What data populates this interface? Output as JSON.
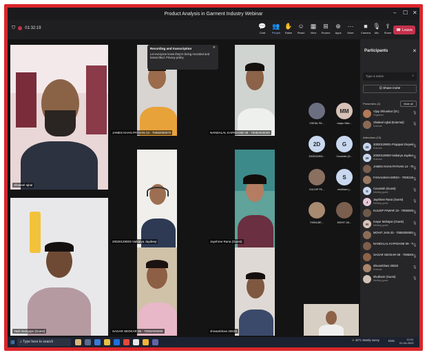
{
  "window": {
    "title": "Product Analysis in Garment Industry Webinar"
  },
  "topbar": {
    "timer": "01:32:19",
    "buttons": [
      {
        "id": "chat",
        "label": "Chat",
        "icon": "chat-icon"
      },
      {
        "id": "people",
        "label": "People",
        "icon": "people-icon"
      },
      {
        "id": "raise",
        "label": "Raise",
        "icon": "hand-icon"
      },
      {
        "id": "react",
        "label": "React",
        "icon": "smile-icon"
      },
      {
        "id": "view",
        "label": "View",
        "icon": "grid-icon"
      },
      {
        "id": "rooms",
        "label": "Rooms",
        "icon": "rooms-icon"
      },
      {
        "id": "apps",
        "label": "Apps",
        "icon": "apps-icon"
      },
      {
        "id": "more",
        "label": "More",
        "icon": "more-icon"
      },
      {
        "id": "camera",
        "label": "Camera",
        "icon": "camera-icon"
      },
      {
        "id": "mic",
        "label": "Mic",
        "icon": "mic-icon"
      },
      {
        "id": "share",
        "label": "Share",
        "icon": "share-icon"
      }
    ],
    "leave_label": "Leave"
  },
  "toast": {
    "title": "Recording and transcription",
    "body": "Let everyone know they're being recorded and transcribed. Privacy policy"
  },
  "tiles": [
    {
      "label": "Shakeel Iqbal"
    },
    {
      "label": "JAMES KHAN PATHAN 13 - 70082000070"
    },
    {
      "label": "NANDALAL KAPADANE 09 - 70082000009"
    },
    {
      "label": "20020129003-Vaikarya Jaydeep"
    },
    {
      "label": "Jayshree Rana (Guest)"
    },
    {
      "label": "Yash Barlgujar (Guest)"
    },
    {
      "label": "SAGAR SEOKAR 06 - 70082000008"
    },
    {
      "label": "shivambhavi 20633"
    }
  ],
  "thumbnails": [
    {
      "initials": "",
      "name": "VISHAL PA..."
    },
    {
      "initials": "MM",
      "name": "mayur Mah..."
    },
    {
      "initials": "2D",
      "name": "2002012900..."
    },
    {
      "initials": "G",
      "name": "Covanish (G..."
    },
    {
      "initials": "",
      "name": "KULDIP PA..."
    },
    {
      "initials": "S",
      "name": "shubham (..."
    },
    {
      "initials": "",
      "name": "FARALBE..."
    },
    {
      "initials": "",
      "name": "MOHIT JAI..."
    }
  ],
  "panel": {
    "title": "Participants",
    "search_placeholder": "Type a name",
    "invite_label": "Share invite",
    "presenters_label": "Presenters (2)",
    "mute_all_label": "Mute all",
    "attendees_label": "Attendees (13)",
    "participants": [
      {
        "initials": "",
        "name": "Vijay Shinarkar (Dr.)",
        "status": "Organizer"
      },
      {
        "initials": "",
        "name": "Shakeel Iqbal (External)",
        "status": "External"
      },
      {
        "initials": "20",
        "name": "20020129001-Prajapati Divyesh",
        "status": "External"
      },
      {
        "initials": "20",
        "name": "20020129003-Vaikarya Jaydeep",
        "status": "External"
      },
      {
        "initials": "",
        "name": "JAMES KHAN PATHAN 13 - 70082...",
        "status": ""
      },
      {
        "initials": "",
        "name": "FAISALBHAI MIRZA - 70081190...",
        "status": ""
      },
      {
        "initials": "G",
        "name": "Covanish (Guest)",
        "status": "Meeting guest"
      },
      {
        "initials": "J",
        "name": "Jayshree Rana (Guest)",
        "status": "Meeting guest"
      },
      {
        "initials": "",
        "name": "KULDIP PAWAR 18 - 70082000018",
        "status": ""
      },
      {
        "initials": "M",
        "name": "mayur Mahajan (Guest)",
        "status": "Meeting guest"
      },
      {
        "initials": "",
        "name": "MOHIT JAIN 33 - 70082000003",
        "status": ""
      },
      {
        "initials": "",
        "name": "NANDALAL KAPADANE 09 - 700...",
        "status": ""
      },
      {
        "initials": "",
        "name": "SAGAR SEOKAR 08 - 70082000008",
        "status": ""
      },
      {
        "initials": "",
        "name": "shivambhavi 20633",
        "status": "External"
      },
      {
        "initials": "",
        "name": "shubham (Guest)",
        "status": "Meeting guest"
      }
    ]
  },
  "taskbar": {
    "search_placeholder": "Type here to search",
    "weather": "33°C Mostly sunny",
    "lang": "ENG",
    "time": "12:01",
    "date": "01-04-2023"
  }
}
